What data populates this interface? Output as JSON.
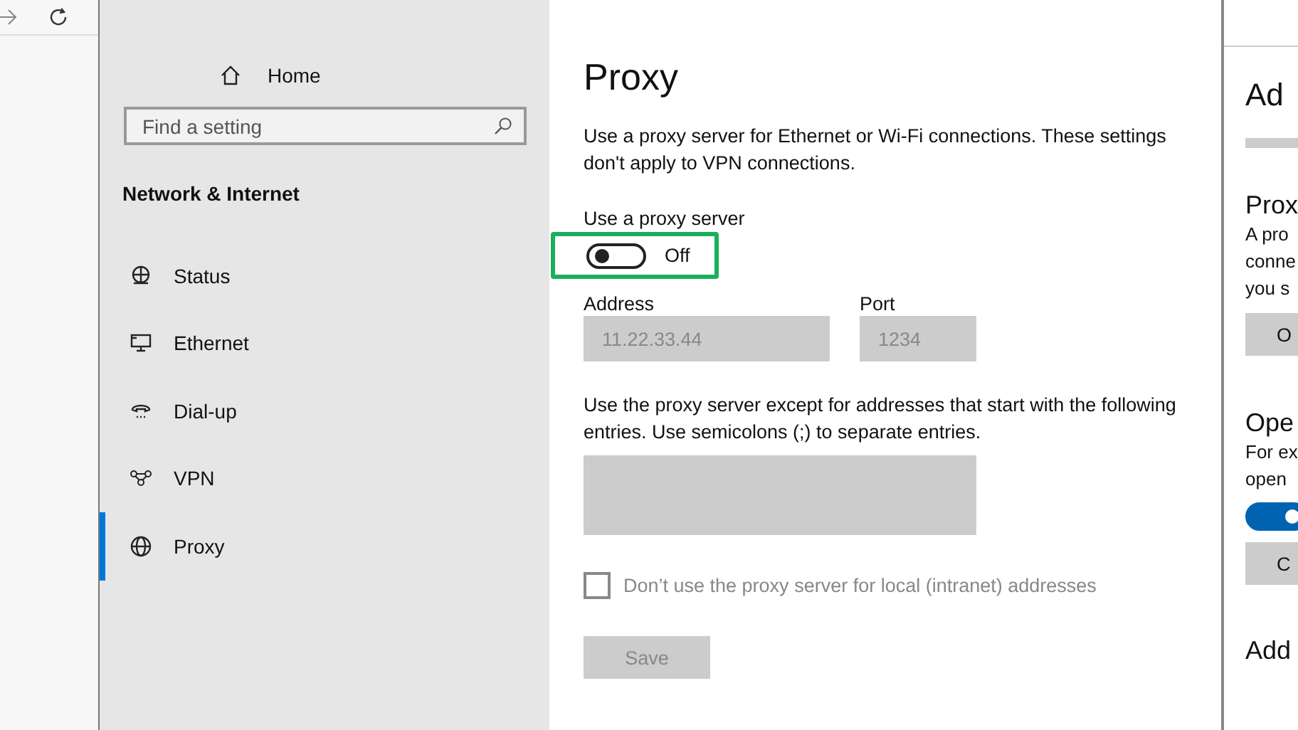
{
  "sidebar": {
    "home": "Home",
    "search": {
      "placeholder": "Find a setting"
    },
    "section_title": "Network & Internet",
    "items": [
      {
        "label": "Status",
        "kind": "status",
        "selected": false
      },
      {
        "label": "Ethernet",
        "kind": "ethernet",
        "selected": false
      },
      {
        "label": "Dial-up",
        "kind": "dialup",
        "selected": false
      },
      {
        "label": "VPN",
        "kind": "vpn",
        "selected": false
      },
      {
        "label": "Proxy",
        "kind": "proxy",
        "selected": true
      }
    ]
  },
  "main": {
    "title": "Proxy",
    "description": "Use a proxy server for Ethernet or Wi-Fi connections. These settings don't apply to VPN connections.",
    "toggle": {
      "label": "Use a proxy server",
      "on": false,
      "state_text": "Off",
      "highlighted": true
    },
    "address": {
      "label": "Address",
      "value": "11.22.33.44",
      "disabled": true
    },
    "port": {
      "label": "Port",
      "value": "1234",
      "disabled": true
    },
    "exceptions": {
      "description": "Use the proxy server except for addresses that start with the following entries. Use semicolons (;) to separate entries.",
      "disabled": true
    },
    "local_checkbox": {
      "label": "Don’t use the proxy server for local (intranet) addresses",
      "checked": false,
      "disabled": true
    },
    "save_button": {
      "label": "Save",
      "disabled": true
    }
  },
  "right_panel": {
    "title": "Ad",
    "section1_title": "Prox",
    "section1_lines": [
      "A pro",
      "conne",
      "you s"
    ],
    "section1_button": "O",
    "section2_title": "Ope",
    "section2_lines": [
      "For ex",
      "open"
    ],
    "toggle": {
      "on": true
    },
    "section2_button": "C",
    "section3_title": "Add"
  }
}
